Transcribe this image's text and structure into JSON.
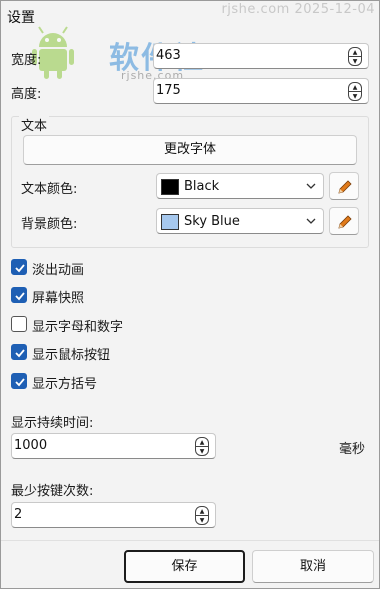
{
  "window": {
    "title": "设置",
    "watermark_top": "rjshe.com 2025-12-04"
  },
  "logo": {
    "name": "软件社",
    "sub": "rjshe.com"
  },
  "size": {
    "width_label": "宽度:",
    "width_value": "463",
    "height_label": "高度:",
    "height_value": "175"
  },
  "text_group": {
    "title": "文本",
    "change_font_label": "更改字体",
    "text_color_label": "文本颜色:",
    "text_color_value": "Black",
    "text_color_hex": "#000000",
    "bg_color_label": "背景颜色:",
    "bg_color_value": "Sky Blue",
    "bg_color_hex": "#a6c8ee"
  },
  "options": [
    {
      "label": "淡出动画",
      "checked": true
    },
    {
      "label": "屏幕快照",
      "checked": true
    },
    {
      "label": "显示字母和数字",
      "checked": false
    },
    {
      "label": "显示鼠标按钮",
      "checked": true
    },
    {
      "label": "显示方括号",
      "checked": true
    }
  ],
  "duration": {
    "label": "显示持续时间:",
    "value": "1000",
    "unit": "毫秒"
  },
  "min_keys": {
    "label": "最少按键次数:",
    "value": "2"
  },
  "footer": {
    "save_label": "保存",
    "cancel_label": "取消"
  },
  "colors": {
    "accent": "#1e5fb4",
    "pen_orange": "#e07a1a"
  }
}
